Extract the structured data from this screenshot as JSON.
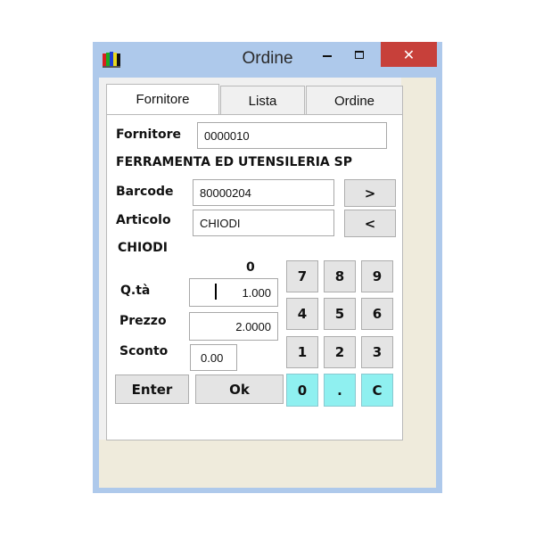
{
  "window": {
    "title": "Ordine",
    "close_glyph": "✕",
    "icons": {
      "app": "app-icon",
      "minimize": "minimize-icon",
      "maximize": "maximize-icon",
      "close": "close-icon"
    }
  },
  "tabs": [
    {
      "label": "Fornitore",
      "active": true
    },
    {
      "label": "Lista",
      "active": false
    },
    {
      "label": "Ordine",
      "active": false
    }
  ],
  "form": {
    "fornitore_label": "Fornitore",
    "fornitore_value": "0000010",
    "supplier_name": "FERRAMENTA ED UTENSILERIA SP",
    "barcode_label": "Barcode",
    "barcode_value": "80000204",
    "articolo_label": "Articolo",
    "articolo_value": "CHIODI",
    "article_desc": "CHIODI",
    "count": "0",
    "qta_label": "Q.tà",
    "qta_value": "1.000",
    "prezzo_label": "Prezzo",
    "prezzo_value": "2.0000",
    "sconto_label": "Sconto",
    "sconto_value": "0.00"
  },
  "buttons": {
    "next": ">",
    "prev": "<",
    "enter": "Enter",
    "ok": "Ok"
  },
  "keypad": [
    "7",
    "8",
    "9",
    "4",
    "5",
    "6",
    "1",
    "2",
    "3",
    "0",
    ".",
    "C"
  ],
  "colors": {
    "titlebar": "#aec9eb",
    "close": "#c7403a",
    "keypad_highlight": "#8ff0f0"
  }
}
